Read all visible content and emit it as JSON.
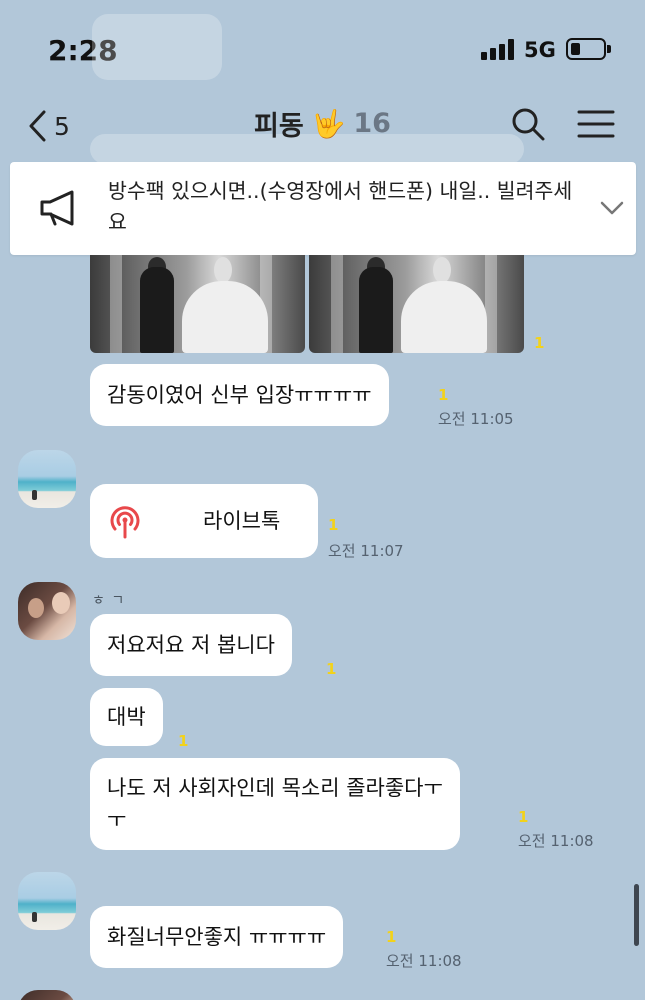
{
  "status_bar": {
    "time": "2:28",
    "network": "5G",
    "signal_bars": 4,
    "battery_level": 0.3
  },
  "header": {
    "back_count": "5",
    "title": "피동",
    "title_emoji": "🤟",
    "member_count": "16"
  },
  "notice": {
    "text": "방수팩 있으시면..(수영장에서 핸드폰) 내일.. 빌려주세요"
  },
  "messages": {
    "photo_unread": "1",
    "m1": {
      "text": "감동이였어 신부 입장ㅠㅠㅠㅠ",
      "unread": "1",
      "time": "오전 11:05"
    },
    "m2": {
      "label": "라이브톡",
      "unread": "1",
      "time": "오전 11:07"
    },
    "m3": {
      "text": "저요저요 저 봅니다",
      "unread": "1"
    },
    "m4": {
      "text": "대박",
      "unread": "1"
    },
    "m5": {
      "line1": "나도 저 사회자인데 목소리 졸라좋다ㅜ",
      "line2": "ㅜ",
      "unread": "1",
      "time": "오전 11:08"
    },
    "m6": {
      "text": "화질너무안좋지 ㅠㅠㅠㅠ",
      "unread": "1",
      "time": "오전 11:08"
    }
  },
  "colors": {
    "background": "#b2c7d9",
    "bubble": "#ffffff",
    "unread": "#f2d21b",
    "live_icon": "#e8484b"
  }
}
